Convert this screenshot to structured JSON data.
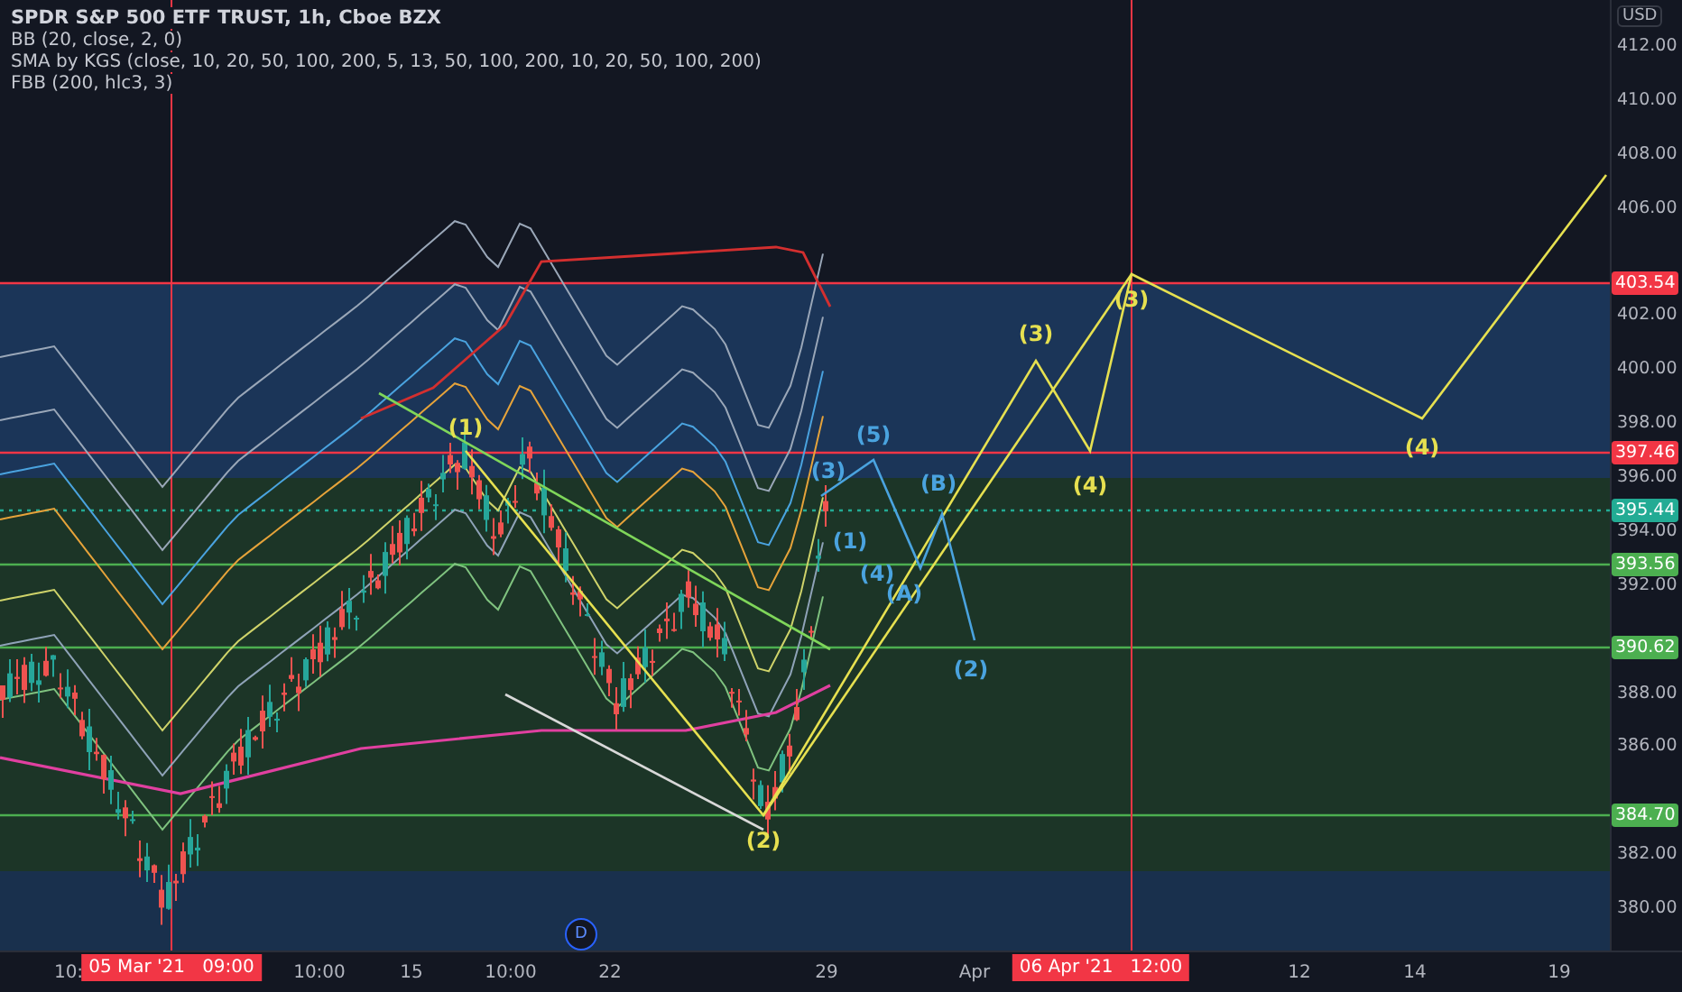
{
  "legend": {
    "title": "SPDR S&P 500 ETF TRUST, 1h, Cboe BZX",
    "indicators": [
      "BB (20, close, 2, 0)",
      "SMA by KGS (close, 10, 20, 50, 100, 200, 5, 13, 50, 100, 200, 10, 20, 50, 100, 200)",
      "FBB (200, hlc3, 3)"
    ]
  },
  "price_axis": {
    "currency": "USD",
    "ticks": [
      "412.00",
      "410.00",
      "408.00",
      "406.00",
      "402.00",
      "400.00",
      "398.00",
      "396.00",
      "394.00",
      "392.00",
      "388.00",
      "386.00",
      "382.00",
      "380.00"
    ]
  },
  "price_tags": [
    {
      "label": "403.54",
      "color": "#f23645"
    },
    {
      "label": "397.46",
      "color": "#f23645"
    },
    {
      "label": "395.44",
      "color": "#22ab94"
    },
    {
      "label": "393.56",
      "color": "#4caf50"
    },
    {
      "label": "390.62",
      "color": "#4caf50"
    },
    {
      "label": "384.70",
      "color": "#4caf50"
    }
  ],
  "time_axis": {
    "ticks": [
      {
        "label": "10:",
        "highlighted": false
      },
      {
        "label": "05 Mar '21   09:00",
        "highlighted": true
      },
      {
        "label": "10:00",
        "highlighted": false
      },
      {
        "label": "15",
        "highlighted": false
      },
      {
        "label": "10:00",
        "highlighted": false
      },
      {
        "label": "22",
        "highlighted": false
      },
      {
        "label": "29",
        "highlighted": false
      },
      {
        "label": "Apr",
        "highlighted": false
      },
      {
        "label": "06 Apr '21   12:00",
        "highlighted": true
      },
      {
        "label": "12",
        "highlighted": false
      },
      {
        "label": "14",
        "highlighted": false
      },
      {
        "label": "19",
        "highlighted": false
      }
    ]
  },
  "wave_labels": [
    {
      "text": "(1)",
      "color": "#e6e050"
    },
    {
      "text": "(2)",
      "color": "#e6e050"
    },
    {
      "text": "(3)",
      "color": "#e6e050"
    },
    {
      "text": "(4)",
      "color": "#e6e050"
    },
    {
      "text": "(3)",
      "color": "#e6e050"
    },
    {
      "text": "(4)",
      "color": "#e6e050"
    },
    {
      "text": "(5)",
      "color": "#4aa3df"
    },
    {
      "text": "(3)",
      "color": "#4aa3df"
    },
    {
      "text": "(B)",
      "color": "#4aa3df"
    },
    {
      "text": "(A)",
      "color": "#4aa3df"
    },
    {
      "text": "(2)",
      "color": "#4aa3df"
    },
    {
      "text": "(4)",
      "color": "#4aa3df"
    },
    {
      "text": "(1)",
      "color": "#4aa3df"
    }
  ],
  "event_marker": "D"
}
